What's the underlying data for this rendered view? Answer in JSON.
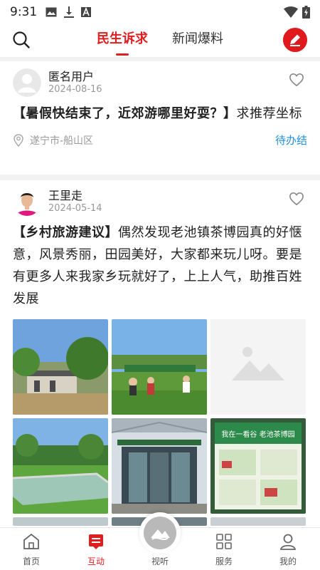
{
  "status_bar": {
    "time": "9:31"
  },
  "nav": {
    "tabs": [
      {
        "label": "民生诉求",
        "active": true
      },
      {
        "label": "新闻爆料",
        "active": false
      }
    ]
  },
  "posts": [
    {
      "author": "匿名用户",
      "date": "2024-08-16",
      "topic": "【暑假快结束了，近郊游哪里好耍？】",
      "content": "求推荐坐标",
      "location": "遂宁市-船山区",
      "status": "待办结"
    },
    {
      "author": "王里走",
      "date": "2024-05-14",
      "topic": "【乡村旅游建议】",
      "content": "偶然发现老池镇茶博园真的好惬意，风景秀丽，田园美好，大家都来玩儿呀。要是有更多人来我家乡玩就好了，上上人气，助推百姓发展",
      "images": [
        "village-courtyard-photo",
        "tea-garden-banner-photo",
        "image-placeholder",
        "pond-lawn-photo",
        "greenhouse-entrance-photo",
        "poster-board-photo"
      ],
      "poster_text": "我在一看谷 老池茶博园"
    }
  ],
  "bottom_nav": {
    "items": [
      {
        "label": "首页",
        "icon": "home-icon"
      },
      {
        "label": "互动",
        "icon": "interaction-icon",
        "active": true
      },
      {
        "label": "视听",
        "icon": "media-icon"
      },
      {
        "label": "服务",
        "icon": "grid-icon"
      },
      {
        "label": "我的",
        "icon": "user-icon"
      }
    ]
  },
  "colors": {
    "accent": "#e01e1e",
    "status_blue": "#1f8fe0"
  }
}
